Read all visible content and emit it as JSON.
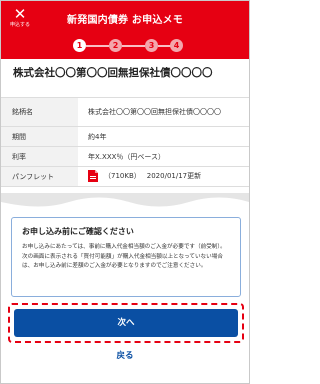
{
  "header": {
    "close_label": "申込する",
    "title": "新発国内債券 お申込メモ",
    "steps": [
      "1",
      "2",
      "3",
      "4"
    ],
    "active_step": 1
  },
  "product": {
    "title": "株式会社〇〇第〇〇回無担保社債〇〇〇〇"
  },
  "info": {
    "rows": [
      {
        "label": "銘柄名",
        "value": "株式会社〇〇第〇〇回無担保社債〇〇〇〇"
      },
      {
        "label": "期間",
        "value": "約4年"
      },
      {
        "label": "利率",
        "value": "年X.XXX％（円ベース）"
      }
    ],
    "pamphlet": {
      "label": "パンフレット",
      "size": "（710KB）",
      "updated": "2020/01/17更新"
    }
  },
  "notice": {
    "title": "お申し込み前にご確認ください",
    "para1": "お申し込みにあたっては、事前に購入代金相当額のご入金が必要です（前受制）。",
    "para2": "次の画面に表示される「買付可能額」が購入代金相当額以上となっていない場合は、お申し込み前に差額のご入金が必要となりますのでご注意ください。"
  },
  "actions": {
    "next_label": "次へ",
    "back_label": "戻る"
  },
  "colors": {
    "brand_red": "#e60012",
    "primary_blue": "#0a4fa3",
    "notice_border": "#8aaedc"
  }
}
